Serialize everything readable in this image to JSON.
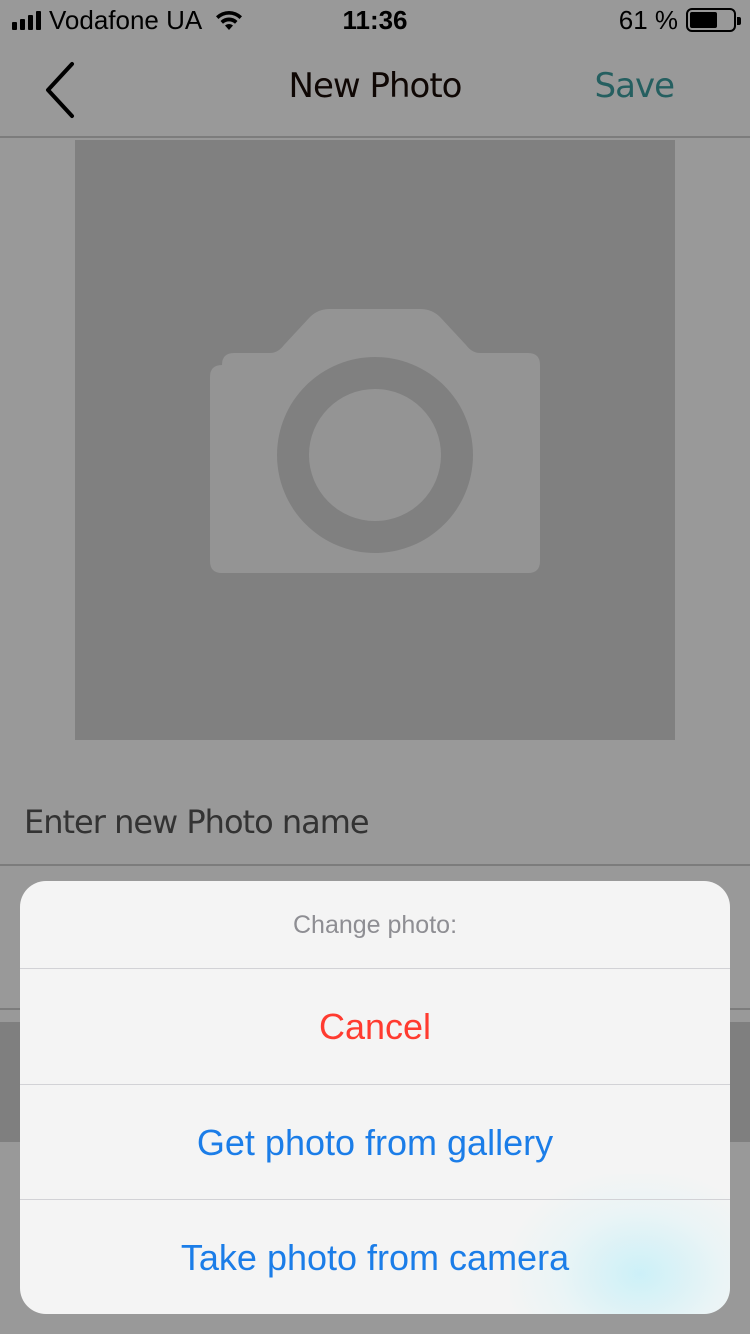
{
  "status_bar": {
    "carrier": "Vodafone UA",
    "time": "11:36",
    "battery": "61 %",
    "battery_level": 0.61
  },
  "nav": {
    "title": "New Photo",
    "save_label": "Save",
    "save_color": "#3e9fa0"
  },
  "photo": {
    "placeholder_icon": "camera-icon"
  },
  "form": {
    "name_placeholder": "Enter new Photo name",
    "name_value": ""
  },
  "action_sheet": {
    "title": "Change photo:",
    "options": [
      {
        "label": "Cancel",
        "style": "destructive",
        "color": "#ff3b30"
      },
      {
        "label": "Get photo from gallery",
        "style": "default",
        "color": "#1b7de8"
      },
      {
        "label": "Take photo from camera",
        "style": "default",
        "color": "#1b7de8"
      }
    ]
  }
}
